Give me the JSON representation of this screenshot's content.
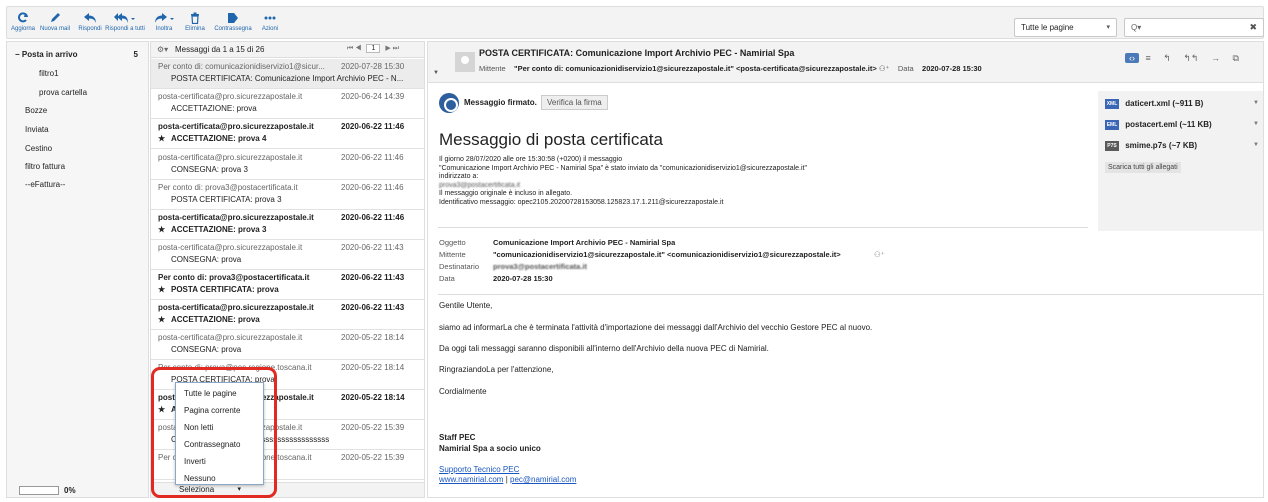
{
  "toolbar": {
    "buttons": [
      {
        "label": "Aggiorna",
        "icon": "refresh-icon"
      },
      {
        "label": "Nuova mail",
        "icon": "pencil-icon"
      },
      {
        "label": "Rispondi",
        "icon": "reply-icon"
      },
      {
        "label": "Rispondi a tutti",
        "icon": "reply-all-icon"
      },
      {
        "label": "Inoltra",
        "icon": "forward-icon"
      },
      {
        "label": "Elimina",
        "icon": "trash-icon"
      },
      {
        "label": "Contrassegna",
        "icon": "tag-icon"
      },
      {
        "label": "Azioni",
        "icon": "more-icon"
      }
    ],
    "scope_select": "Tutte le pagine",
    "search_placeholder": "Q▾",
    "clear_search": "✖"
  },
  "folders": {
    "items": [
      {
        "label": "Posta in arrivo",
        "count": "5",
        "active": true
      },
      {
        "label": "filtro1"
      },
      {
        "label": "prova cartella"
      },
      {
        "label": "Bozze"
      },
      {
        "label": "Inviata"
      },
      {
        "label": "Cestino"
      },
      {
        "label": "filtro fattura"
      },
      {
        "label": "--eFattura--"
      }
    ],
    "quota": "0%",
    "collapse_glyph": "−"
  },
  "message_list": {
    "range_label": "Messaggi da 1 a 15 di 26",
    "page": "1",
    "pager_first": "⏮",
    "pager_prev": "◀",
    "pager_next": "▶",
    "pager_last": "⏭",
    "select_label": "Seleziona",
    "messages": [
      {
        "from": "Per conto di: comunicazionidiservizio1@sicur...",
        "date": "2020-07-28 15:30",
        "subject": "POSTA CERTIFICATA: Comunicazione Import Archivio PEC - N...",
        "unread": false,
        "flag": false
      },
      {
        "from": "posta-certificata@pro.sicurezzapostale.it",
        "date": "2020-06-24 14:39",
        "subject": "ACCETTAZIONE: prova",
        "unread": false,
        "flag": false
      },
      {
        "from": "posta-certificata@pro.sicurezzapostale.it",
        "date": "2020-06-22 11:46",
        "subject": "ACCETTAZIONE: prova 4",
        "unread": true,
        "flag": true
      },
      {
        "from": "posta-certificata@pro.sicurezzapostale.it",
        "date": "2020-06-22 11:46",
        "subject": "CONSEGNA: prova 3",
        "unread": false,
        "flag": false
      },
      {
        "from": "Per conto di: prova3@postacertificata.it",
        "date": "2020-06-22 11:46",
        "subject": "POSTA CERTIFICATA: prova 3",
        "unread": false,
        "flag": false
      },
      {
        "from": "posta-certificata@pro.sicurezzapostale.it",
        "date": "2020-06-22 11:46",
        "subject": "ACCETTAZIONE: prova 3",
        "unread": true,
        "flag": true
      },
      {
        "from": "posta-certificata@pro.sicurezzapostale.it",
        "date": "2020-06-22 11:43",
        "subject": "CONSEGNA: prova",
        "unread": false,
        "flag": false
      },
      {
        "from": "Per conto di: prova3@postacertificata.it",
        "date": "2020-06-22 11:43",
        "subject": "POSTA CERTIFICATA: prova",
        "unread": true,
        "flag": true
      },
      {
        "from": "posta-certificata@pro.sicurezzapostale.it",
        "date": "2020-06-22 11:43",
        "subject": "ACCETTAZIONE: prova",
        "unread": true,
        "flag": true
      },
      {
        "from": "posta-certificata@pro.sicurezzapostale.it",
        "date": "2020-05-22 18:14",
        "subject": "CONSEGNA: prova",
        "unread": false,
        "flag": false
      },
      {
        "from": "Per conto di: prova@pec.regione.toscana.it",
        "date": "2020-05-22 18:14",
        "subject": "POSTA CERTIFICATA: prova",
        "unread": false,
        "flag": false
      },
      {
        "from": "posta-certificata@pro.sicurezzapostale.it",
        "date": "2020-05-22 18:14",
        "subject": "ACCETTAZIONE: prova",
        "unread": true,
        "flag": true
      },
      {
        "from": "posta-certificata@pro.sicurezzapostale.it",
        "date": "2020-05-22 15:39",
        "subject": "CONSEGNA: sssssssssssssssssssssssssss",
        "unread": false,
        "flag": false
      },
      {
        "from": "Per conto di: prova@pec.regione.toscana.it",
        "date": "2020-05-22 15:39",
        "subject": "",
        "unread": false,
        "flag": false
      }
    ],
    "select_menu": [
      "Tutte le pagine",
      "Pagina corrente",
      "Non letti",
      "Contrassegnato",
      "Inverti",
      "Nessuno"
    ]
  },
  "preview": {
    "title": "POSTA CERTIFICATA: Comunicazione Import Archivio PEC - Namirial Spa",
    "from_label": "Mittente",
    "from_value": "\"Per conto di: comunicazionidiservizio1@sicurezzapostale.it\" <posta-certificata@sicurezzapostale.it>",
    "date_label": "Data",
    "date_value": "2020-07-28 15:30",
    "signature_status": "Messaggio firmato.",
    "verify_button": "Verifica la firma",
    "heading": "Messaggio di posta certificata",
    "cert_lines": [
      "Il giorno 28/07/2020 alle ore 15:30:58 (+0200) il messaggio",
      "\"Comunicazione Import Archivio PEC - Namirial Spa\" è stato inviato da \"comunicazionidiservizio1@sicurezzapostale.it\"",
      "indirizzato a:",
      "prova3@postacertificata.it",
      "Il messaggio originale è incluso in allegato.",
      "Identificativo messaggio: opec2105.20200728153058.125823.17.1.211@sicurezzapostale.it"
    ],
    "attachments": [
      {
        "name": "daticert.xml (~911 B)",
        "type": "XML",
        "color": "#3b66b5"
      },
      {
        "name": "postacert.eml (~11 KB)",
        "type": "EML",
        "color": "#3b66b5"
      },
      {
        "name": "smime.p7s (~7 KB)",
        "type": "P7S",
        "color": "#5a5a5a"
      }
    ],
    "download_all": "Scarica tutti gli allegati",
    "headers": [
      {
        "k": "Oggetto",
        "v": "Comunicazione Import Archivio PEC - Namirial Spa"
      },
      {
        "k": "Mittente",
        "v": "\"comunicazionidiservizio1@sicurezzapostale.it\" <comunicazionidiservizio1@sicurezzapostale.it>"
      },
      {
        "k": "Destinatario",
        "v": "prova3@postacertificata.it"
      },
      {
        "k": "Data",
        "v": "2020-07-28 15:30"
      }
    ],
    "body": [
      "Gentile Utente,",
      "siamo ad informarLa che è terminata l'attività d'importazione dei messaggi dall'Archivio del vecchio Gestore PEC al nuovo.",
      "Da oggi tali messaggi saranno disponibili all'interno dell'Archivio della nuova PEC di Namirial.",
      "RingraziandoLa per l'attenzione,",
      "Cordialmente"
    ],
    "sign_1": "Staff PEC",
    "sign_2": "Namirial Spa a socio unico",
    "link_support": "Supporto Tecnico PEC",
    "link_site": "www.namirial.com",
    "link_sep": " | ",
    "link_mail": "pec@namirial.com",
    "tools": [
      "‹›",
      "≡",
      "↰",
      "↰↰",
      "→",
      "⧉"
    ]
  }
}
